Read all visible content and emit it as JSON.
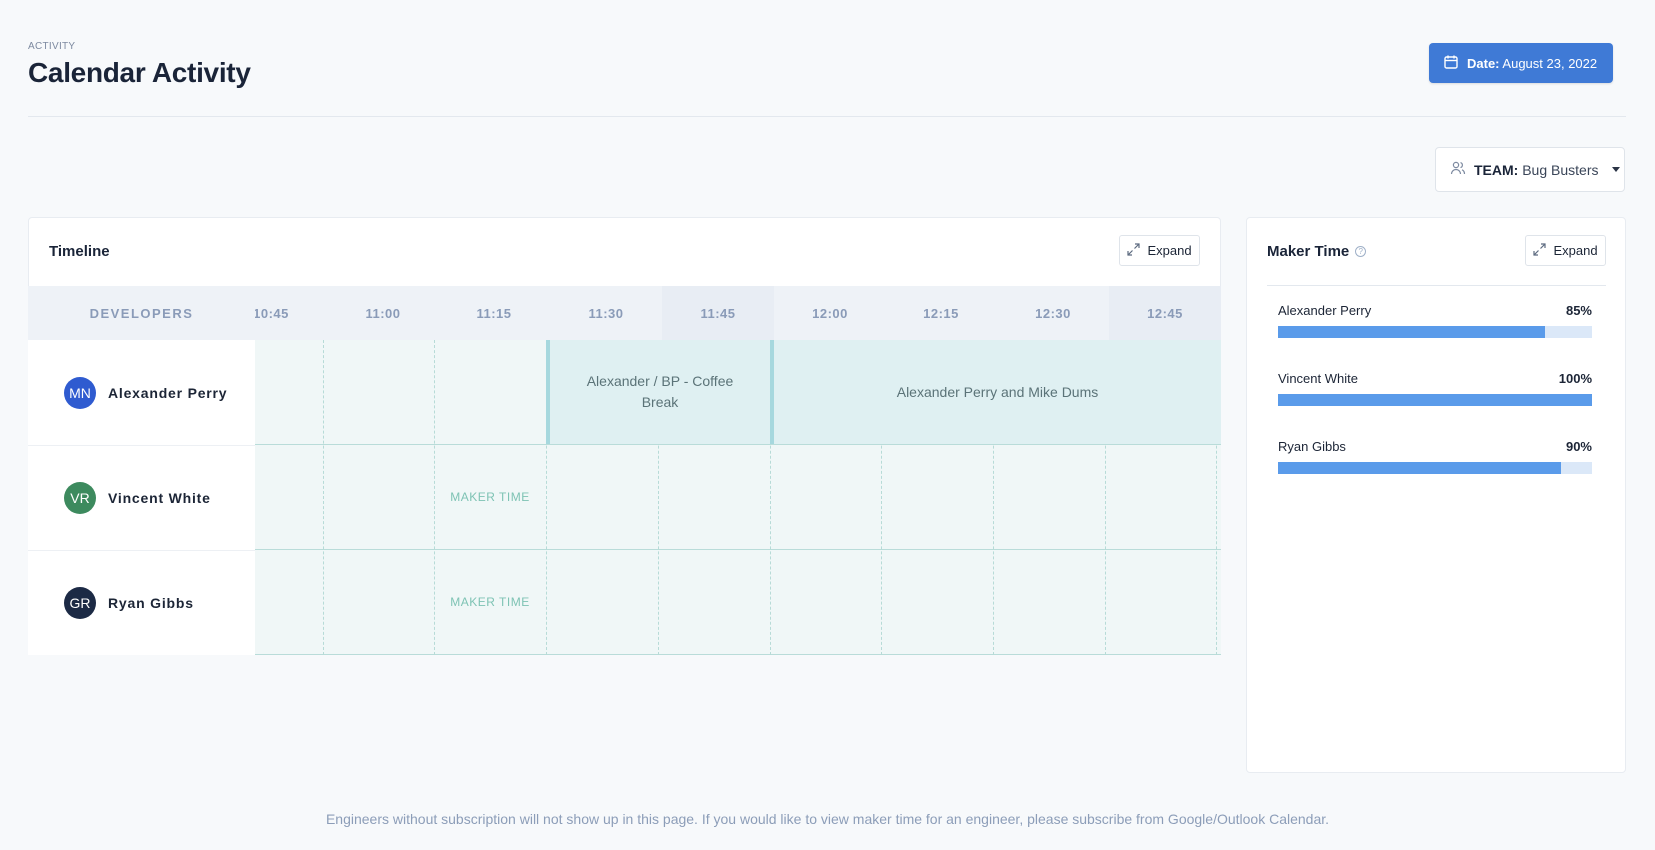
{
  "header": {
    "eyebrow": "ACTIVITY",
    "title": "Calendar Activity",
    "date_label": "Date:",
    "date_value": "August 23, 2022",
    "calendar_icon": "calendar-icon"
  },
  "team": {
    "label": "TEAM:",
    "value": "Bug Busters",
    "icon": "users-icon"
  },
  "timeline": {
    "title": "Timeline",
    "expand_label": "Expand",
    "developers_header": "DEVELOPERS",
    "times": [
      "10:45",
      "11:00",
      "11:15",
      "11:30",
      "11:45",
      "12:00",
      "12:15",
      "12:30",
      "12:45"
    ],
    "developers": [
      {
        "initials": "MN",
        "name": "Alexander Perry",
        "color": "#2f5bd0"
      },
      {
        "initials": "VR",
        "name": "Vincent White",
        "color": "#3d8a5e"
      },
      {
        "initials": "GR",
        "name": "Ryan Gibbs",
        "color": "#1c2a45"
      }
    ],
    "events": [
      {
        "title": "Alexander / BP - Coffee Break"
      },
      {
        "title": "Alexander Perry and Mike Dums"
      }
    ],
    "maker_label": "MAKER TIME"
  },
  "maker_time": {
    "title": "Maker Time",
    "expand_label": "Expand",
    "items": [
      {
        "name": "Alexander Perry",
        "percent_label": "85%",
        "percent": 85
      },
      {
        "name": "Vincent White",
        "percent_label": "100%",
        "percent": 100
      },
      {
        "name": "Ryan Gibbs",
        "percent_label": "90%",
        "percent": 90
      }
    ]
  },
  "footer": {
    "note": "Engineers without subscription will not show up in this page. If you would like to view maker time for an engineer, please subscribe from Google/Outlook Calendar."
  },
  "colors": {
    "accent": "#3f7ad6",
    "bar_fill": "#5a9bea",
    "bar_track": "#dbe8f8",
    "event_bg": "#dff0f2",
    "timeline_bg": "#f0f7f7"
  }
}
